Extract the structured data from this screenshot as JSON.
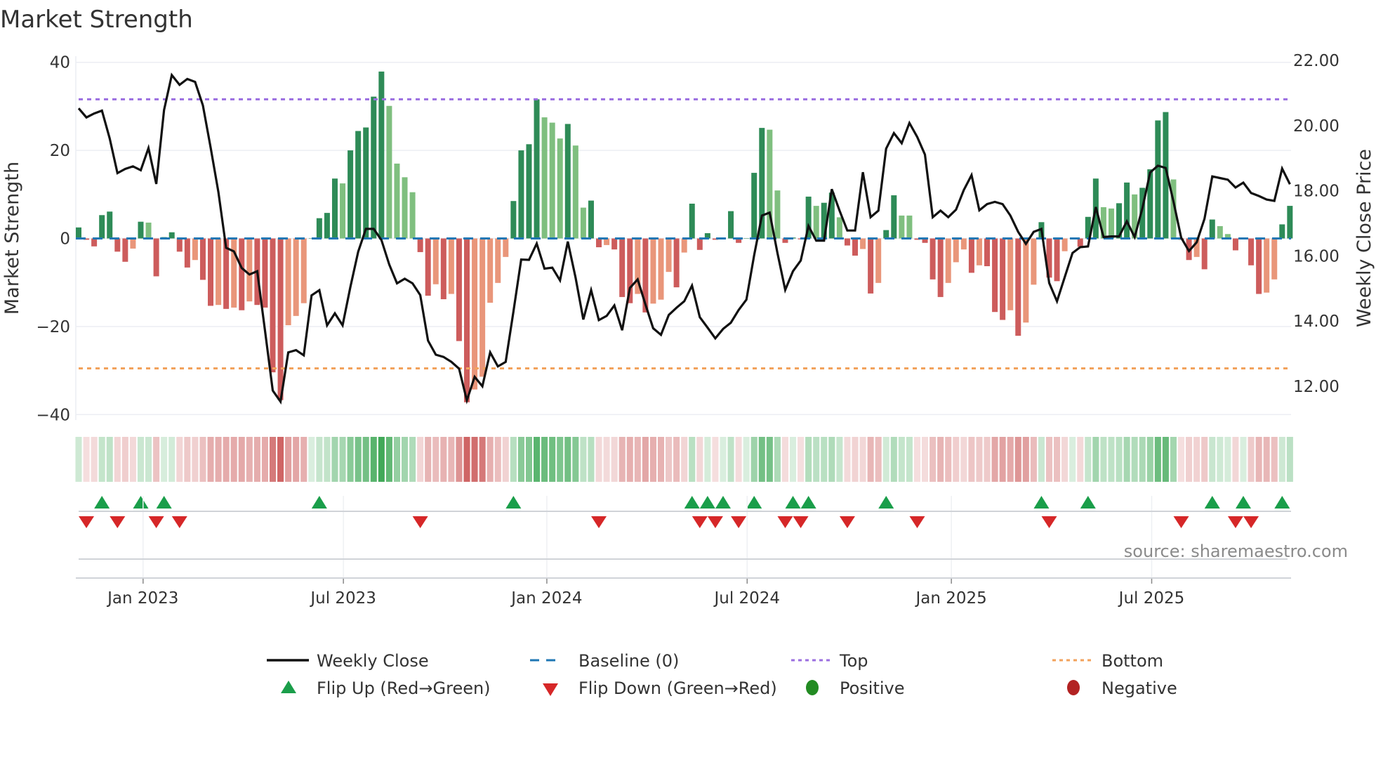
{
  "title": "Market Strength",
  "source": "source: sharemaestro.com",
  "colors": {
    "pos_dark": "#2e8b57",
    "pos_light": "#7fbf7f",
    "neg_dark": "#cd5c5c",
    "neg_light": "#e9967a",
    "line": "#111111",
    "baseline": "#1f77b4",
    "top": "#9b6fe0",
    "bottom": "#f2a25c",
    "flip_up": "#1a9e4a",
    "flip_down": "#d62728",
    "positive": "#228b22",
    "negative": "#b22222"
  },
  "legend": {
    "weekly_close": "Weekly Close",
    "baseline": "Baseline (0)",
    "top": "Top",
    "bottom": "Bottom",
    "flip_up": "Flip Up (Red→Green)",
    "flip_down": "Flip Down (Green→Red)",
    "positive": "Positive",
    "negative": "Negative"
  },
  "chart_data": {
    "type": "bar",
    "title": "Market Strength",
    "ylabel": "Market Strength",
    "y2label": "Weekly Close Price",
    "ylim": [
      -40,
      40
    ],
    "y2lim": [
      12,
      22
    ],
    "yticks": [
      "40",
      "20",
      "0",
      "−20",
      "−40"
    ],
    "ytick_values": [
      40,
      20,
      0,
      -20,
      -40
    ],
    "y2ticks": [
      "22.00",
      "20.00",
      "18.00",
      "16.00",
      "14.00",
      "12.00"
    ],
    "y2tick_values": [
      22,
      20,
      18,
      16,
      14,
      12
    ],
    "xticks": [
      "Jan 2023",
      "Jul 2023",
      "Jan 2024",
      "Jul 2024",
      "Jan 2025",
      "Jul 2025"
    ],
    "xtick_week_index": [
      8.3,
      34.1,
      60.3,
      86.1,
      112.4,
      138.2
    ],
    "top_level": 31.6,
    "bottom_level": -29.5,
    "baseline": 0,
    "series": [
      {
        "name": "Market Strength",
        "values": [
          2.5,
          -0.3,
          -1.8,
          5.3,
          6.1,
          -3,
          -5.3,
          -2.3,
          3.8,
          3.6,
          -8.6,
          0.3,
          1.4,
          -3,
          -6.6,
          -4.9,
          -9.4,
          -15.3,
          -15.1,
          -16,
          -15.7,
          -16.3,
          -14.3,
          -15.1,
          -15.7,
          -30.4,
          -36.7,
          -19.7,
          -17.6,
          -14.7,
          0,
          4.6,
          5.8,
          13.6,
          12.5,
          20,
          24.4,
          25.2,
          32.2,
          37.9,
          30.1,
          17,
          13.9,
          10.5,
          -3.1,
          -13,
          -10.4,
          -13.8,
          -12.6,
          -23.3,
          -37.2,
          -34.3,
          -31.4,
          -14.6,
          -10.1,
          -4.2,
          8.5,
          20,
          21.4,
          31.6,
          27.5,
          26.3,
          22.7,
          26,
          21.1,
          7,
          8.6,
          -2,
          -1.5,
          -2.5,
          -13.3,
          -14.7,
          -12.6,
          -16.8,
          -14.8,
          -13.9,
          -7.6,
          -11.1,
          -3.2,
          7.9,
          -2.6,
          1.2,
          -0.3,
          0.2,
          6.2,
          -1,
          0,
          14.9,
          25.1,
          24.7,
          10.9,
          -1,
          0.2,
          -0.2,
          9.5,
          7.4,
          8.1,
          10.4,
          4.8,
          -1.6,
          -3.9,
          -2.4,
          -12.5,
          -10.1,
          1.9,
          9.8,
          5.2,
          5.2,
          -0.3,
          -1,
          -9.3,
          -13.3,
          -10.1,
          -5.4,
          -2.5,
          -7.8,
          -6.1,
          -6.3,
          -16.7,
          -18.5,
          -16.3,
          -22.1,
          -19.1,
          -10.5,
          3.7,
          -8.9,
          -9.7,
          -2.9,
          0,
          -1.9,
          4.9,
          13.6,
          7.1,
          6.8,
          8,
          12.7,
          10,
          11.5,
          15.7,
          26.8,
          28.7,
          13.4,
          -0.3,
          -4.9,
          -4.2,
          -7,
          4.3,
          2.8,
          1,
          -2.7,
          0.2,
          -6.1,
          -12.6,
          -12.3,
          -9.3,
          3.2,
          7.4
        ]
      },
      {
        "name": "Weekly Close",
        "axis": "right",
        "values": [
          20.53,
          20.25,
          20.37,
          20.46,
          19.61,
          18.54,
          18.67,
          18.75,
          18.63,
          19.31,
          18.21,
          20.48,
          21.55,
          21.25,
          21.43,
          21.34,
          20.62,
          19.33,
          17.96,
          16.25,
          16.14,
          15.63,
          15.43,
          15.53,
          13.72,
          11.87,
          11.53,
          13.04,
          13.11,
          12.95,
          14.79,
          14.95,
          13.87,
          14.24,
          13.87,
          15.05,
          16.13,
          16.83,
          16.83,
          16.49,
          15.74,
          15.16,
          15.3,
          15.16,
          14.8,
          13.4,
          12.97,
          12.9,
          12.75,
          12.54,
          11.57,
          12.29,
          12.0,
          13.04,
          12.61,
          12.75,
          14.3,
          15.89,
          15.88,
          16.38,
          15.61,
          15.64,
          15.25,
          16.44,
          15.34,
          14.05,
          14.95,
          14.03,
          14.16,
          14.48,
          13.72,
          15.02,
          15.28,
          14.51,
          13.78,
          13.58,
          14.19,
          14.41,
          14.61,
          15.09,
          14.12,
          13.8,
          13.47,
          13.76,
          13.95,
          14.34,
          14.66,
          16.02,
          17.24,
          17.33,
          16.09,
          14.96,
          15.53,
          15.86,
          16.92,
          16.47,
          16.47,
          18.05,
          17.39,
          16.78,
          16.78,
          18.57,
          17.19,
          17.39,
          19.29,
          19.77,
          19.46,
          20.08,
          19.65,
          19.11,
          17.19,
          17.39,
          17.19,
          17.42,
          18.02,
          18.48,
          17.4,
          17.59,
          17.66,
          17.59,
          17.24,
          16.74,
          16.37,
          16.74,
          16.83,
          15.17,
          14.61,
          15.35,
          16.09,
          16.27,
          16.29,
          17.5,
          16.58,
          16.6,
          16.6,
          17.06,
          16.58,
          17.46,
          18.56,
          18.77,
          18.7,
          17.67,
          16.56,
          16.15,
          16.42,
          17.14,
          18.44,
          18.39,
          18.34,
          18.1,
          18.25,
          17.93,
          17.84,
          17.73,
          17.69,
          18.68,
          18.2
        ]
      }
    ],
    "legend_position": "bottom",
    "grid": true
  }
}
